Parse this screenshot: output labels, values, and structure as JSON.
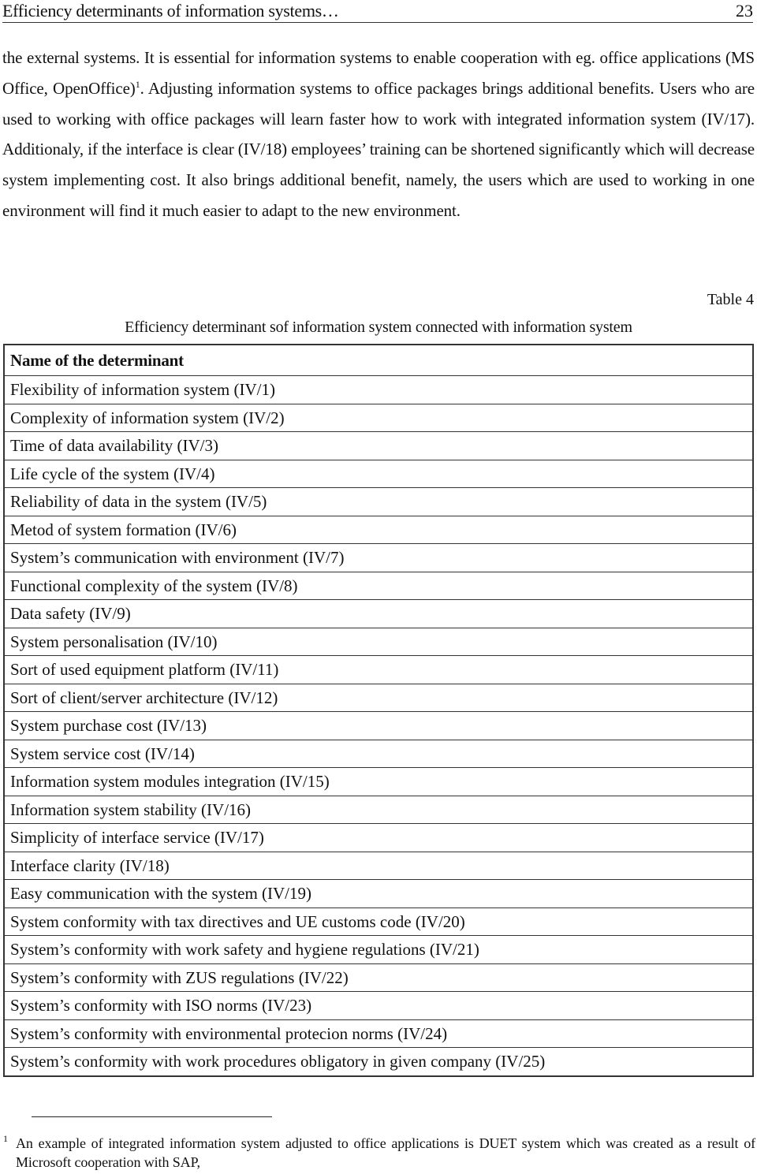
{
  "header": {
    "title": "Efficiency determinants of information systems…",
    "page_number": "23"
  },
  "body": {
    "paragraph_part1": "the external systems. It is essential for information systems to enable cooperation with eg. office applications (MS Office, OpenOffice)",
    "footnote_ref": "1",
    "paragraph_part2": ". Adjusting information systems to office packages brings additional benefits. Users who are used to working with office packages will learn faster how to work with integrated information system (IV/17). Additionaly, if the interface is clear (IV/18) employees’ training can be shortened significantly which will decrease system implementing cost. It also brings additional benefit, namely, the users which are used to working in one environment will find it much easier to adapt to the new environment."
  },
  "table": {
    "label": "Table 4",
    "caption": "Efficiency determinant sof information system connected with information system",
    "header": "Name of the determinant",
    "rows": [
      "Flexibility of information system (IV/1)",
      "Complexity of information system (IV/2)",
      "Time of data availability (IV/3)",
      "Life cycle of the system (IV/4)",
      "Reliability of data in the system (IV/5)",
      "Metod of system formation (IV/6)",
      "System’s communication with environment (IV/7)",
      "Functional complexity of the system (IV/8)",
      "Data safety (IV/9)",
      "System personalisation (IV/10)",
      "Sort of used equipment platform (IV/11)",
      "Sort of client/server architecture (IV/12)",
      "System purchase cost (IV/13)",
      "System service cost (IV/14)",
      "Information system modules integration (IV/15)",
      "Information system stability (IV/16)",
      "Simplicity of interface service (IV/17)",
      "Interface clarity (IV/18)",
      "Easy communication with the system (IV/19)",
      "System conformity with tax directives and UE customs code (IV/20)",
      "System’s conformity with work safety and hygiene regulations (IV/21)",
      "System’s conformity with ZUS regulations (IV/22)",
      "System’s conformity with ISO norms (IV/23)",
      "System’s conformity with environmental protecion norms (IV/24)",
      "System’s conformity with work procedures obligatory in given company (IV/25)"
    ]
  },
  "footnote": {
    "mark": "1",
    "text": "An example of integrated information system adjusted to office applications is DUET system which was created as a result of Microsoft cooperation with SAP,"
  }
}
